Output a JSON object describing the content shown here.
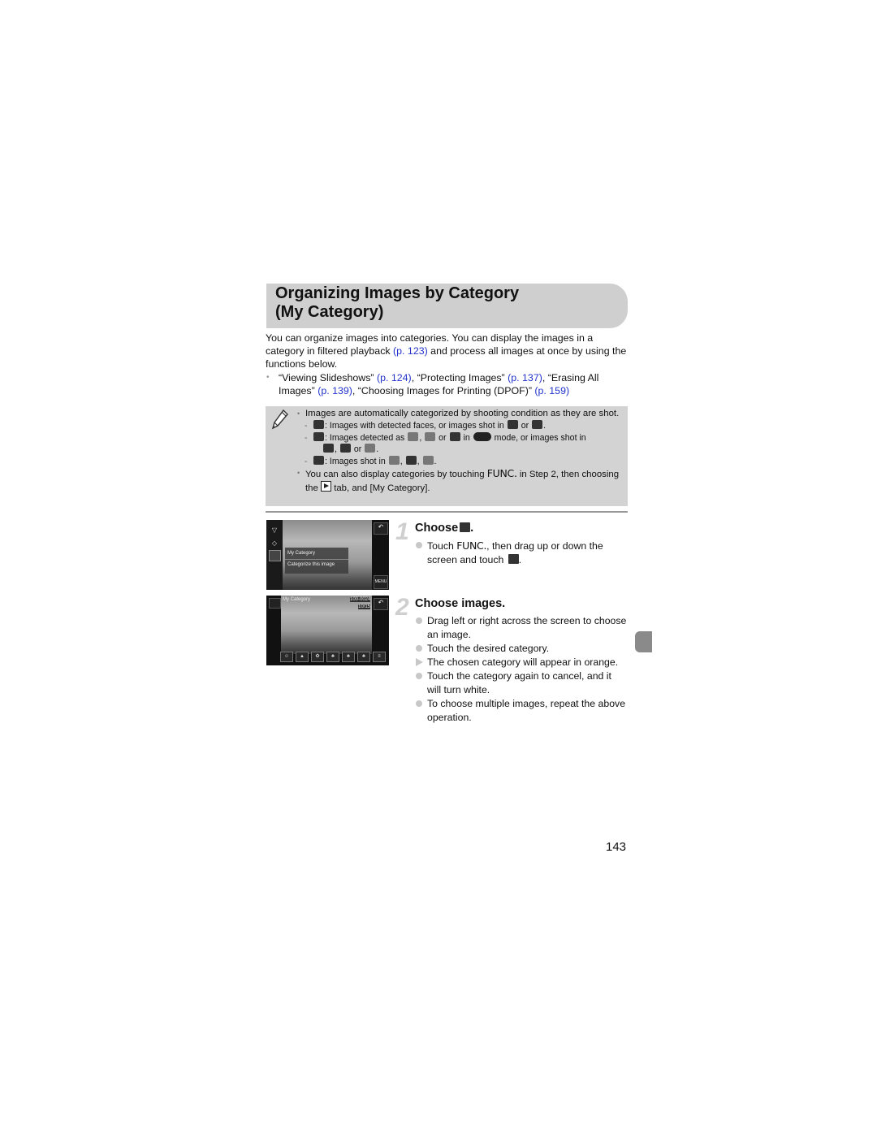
{
  "page": {
    "title_line1": "Organizing Images by Category",
    "title_line2": "(My Category)",
    "intro": {
      "text1": "You can organize images into categories. You can display the images in a category in filtered playback ",
      "link1": "(p. 123)",
      "text2": " and process all images at once by using the functions below."
    },
    "functions_bullet": {
      "t1": "“Viewing Slideshows” ",
      "l1": "(p. 124)",
      "t2": ", “Protecting Images” ",
      "l2": "(p. 137)",
      "t3": ", “Erasing All Images” ",
      "l3": "(p. 139)",
      "t4": ", “Choosing Images for Printing (DPOF)” ",
      "l4": "(p. 159)"
    },
    "note": {
      "icon": "pencil-icon",
      "bullet1": "Images are automatically categorized by shooting condition as they are shot.",
      "sub1": ": Images with detected faces, or images shot in",
      "sub1_or": "or",
      "sub2a": ": Images detected as",
      "sub2_or": "or",
      "sub2_in": "in",
      "sub2b": "mode, or images shot in",
      "sub2_or2": "or",
      "sub3": ": Images shot in",
      "bullet2a": "You can also display categories by touching",
      "func_label": "FUNC.",
      "bullet2b": "in Step 2, then choosing the",
      "bullet2c": "tab, and [My Category]."
    },
    "screen1": {
      "popup_title": "My Category",
      "popup_item": "Categorize this image",
      "back_label": "↶",
      "menu_label": "MENU"
    },
    "screen2": {
      "label": "My Category",
      "file_number": "100-0024",
      "image_count": "10/15",
      "back_label": "↶"
    },
    "step1": {
      "number": "1",
      "title": "Choose",
      "instr_a": "Touch",
      "func_label": "FUNC.",
      "instr_b": ", then drag up or down the screen and touch"
    },
    "step2": {
      "number": "2",
      "title": "Choose images.",
      "items": [
        {
          "type": "bullet",
          "text": "Drag left or right across the screen to choose an image."
        },
        {
          "type": "bullet",
          "text": "Touch the desired category."
        },
        {
          "type": "result",
          "text": "The chosen category will appear in orange."
        },
        {
          "type": "bullet",
          "text": "Touch the category again to cancel, and it will turn white."
        },
        {
          "type": "bullet",
          "text": "To choose multiple images, repeat the above operation."
        }
      ]
    },
    "page_number": "143"
  }
}
